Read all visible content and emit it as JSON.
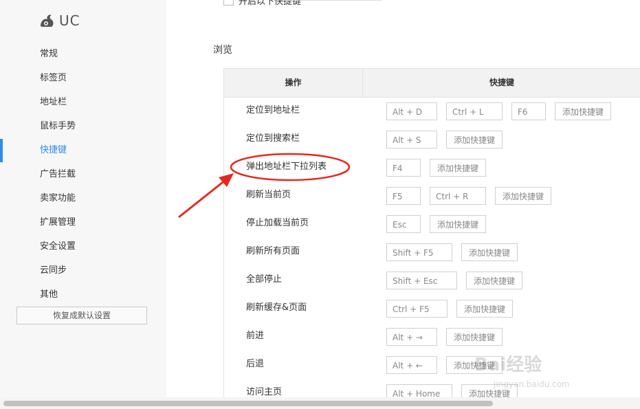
{
  "logo": {
    "icon": "uc-squirrel-icon",
    "text": "UC"
  },
  "sidebar": {
    "items": [
      {
        "label": "常规"
      },
      {
        "label": "标签页"
      },
      {
        "label": "地址栏"
      },
      {
        "label": "鼠标手势"
      },
      {
        "label": "快捷键"
      },
      {
        "label": "广告拦截"
      },
      {
        "label": "卖家功能"
      },
      {
        "label": "扩展管理"
      },
      {
        "label": "安全设置"
      },
      {
        "label": "云同步"
      },
      {
        "label": "其他"
      }
    ],
    "active_index": 4,
    "reset_label": "恢复成默认设置"
  },
  "top_option": {
    "label": "开启以下快捷键",
    "checked": false
  },
  "section": {
    "title": "浏览"
  },
  "table": {
    "col_action": "操作",
    "col_shortcut": "快捷键",
    "add_label": "添加快捷键",
    "rows": [
      {
        "action": "定位到地址栏",
        "keys": [
          "Alt + D",
          "Ctrl + L",
          "F6"
        ]
      },
      {
        "action": "定位到搜索栏",
        "keys": [
          "Alt + S"
        ]
      },
      {
        "action": "弹出地址栏下拉列表",
        "keys": [
          "F4"
        ]
      },
      {
        "action": "刷新当前页",
        "keys": [
          "F5",
          "Ctrl + R"
        ]
      },
      {
        "action": "停止加载当前页",
        "keys": [
          "Esc"
        ]
      },
      {
        "action": "刷新所有页面",
        "keys": [
          "Shift + F5"
        ]
      },
      {
        "action": "全部停止",
        "keys": [
          "Shift + Esc"
        ]
      },
      {
        "action": "刷新缓存&页面",
        "keys": [
          "Ctrl + F5"
        ]
      },
      {
        "action": "前进",
        "keys": [
          "Alt + →"
        ]
      },
      {
        "action": "后退",
        "keys": [
          "Alt + ←"
        ]
      },
      {
        "action": "访问主页",
        "keys": [
          "Alt + Home"
        ]
      }
    ]
  },
  "colors": {
    "accent": "#2f8ce9",
    "annotation": "#e8271b"
  },
  "watermark": {
    "main": "Bai经验",
    "sub": "jingyan.baidu.com"
  }
}
